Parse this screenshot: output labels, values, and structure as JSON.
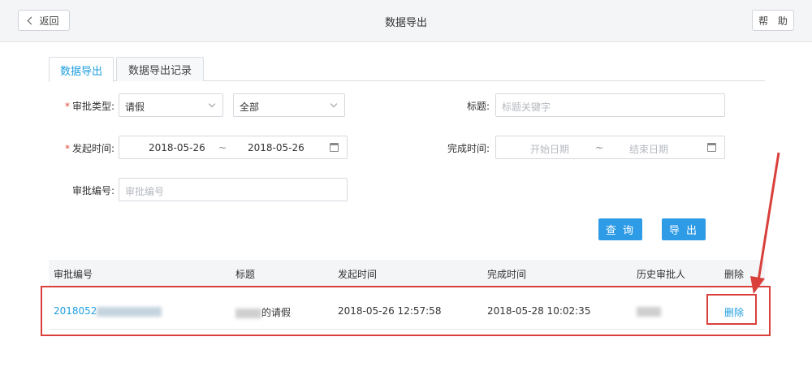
{
  "topbar": {
    "back_label": "返回",
    "title": "数据导出",
    "help_label": "帮 助"
  },
  "tabs": [
    {
      "label": "数据导出",
      "active": true
    },
    {
      "label": "数据导出记录",
      "active": false
    }
  ],
  "form": {
    "approval_type": {
      "label": "审批类型",
      "required": true,
      "value": "请假"
    },
    "approval_status": {
      "value": "全部"
    },
    "title": {
      "label": "标题",
      "placeholder": "标题关键字"
    },
    "start_time": {
      "label": "发起时间",
      "required": true,
      "from": "2018-05-26",
      "separator": "~",
      "to": "2018-05-26"
    },
    "finish_time": {
      "label": "完成时间",
      "from_placeholder": "开始日期",
      "separator": "~",
      "to_placeholder": "结束日期"
    },
    "approval_no": {
      "label": "审批编号",
      "placeholder": "审批编号"
    }
  },
  "buttons": {
    "search_label": "查 询",
    "export_label": "导 出"
  },
  "table": {
    "columns": [
      "审批编号",
      "标题",
      "发起时间",
      "完成时间",
      "历史审批人",
      "删除"
    ],
    "rows": [
      {
        "approval_no": "2018052",
        "title_suffix": "的请假",
        "start_time": "2018-05-26 12:57:58",
        "finish_time": "2018-05-28 10:02:35",
        "delete_label": "删除"
      }
    ]
  },
  "colors": {
    "accent": "#1e9ee0",
    "button": "#2e9be6",
    "highlight": "#d9403b"
  }
}
